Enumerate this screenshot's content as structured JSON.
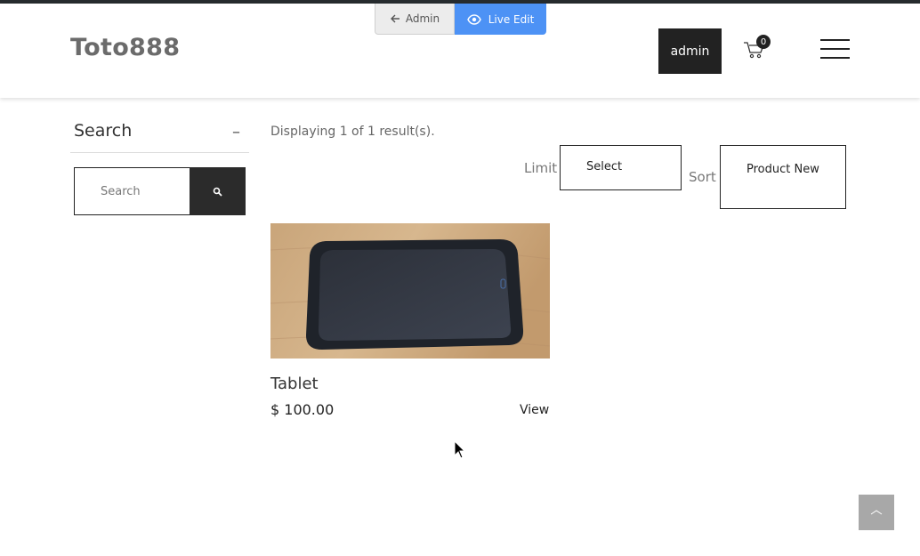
{
  "admin_bar": {
    "admin_label": "Admin",
    "live_edit_label": "Live Edit"
  },
  "header": {
    "logo": "Toto888",
    "user_button": "admin",
    "cart_count": "0"
  },
  "sidebar": {
    "title": "Search",
    "toggle": "–",
    "search_placeholder": "Search"
  },
  "toolbar": {
    "results_text": "Displaying 1 of 1 result(s).",
    "limit_label": "Limit",
    "limit_value": "Select",
    "sort_label": "Sort",
    "sort_value": "Product New"
  },
  "products": [
    {
      "name": "Tablet",
      "price": "$ 100.00",
      "view_label": "View"
    }
  ],
  "colors": {
    "live_edit": "#4d92f5",
    "dark": "#222222",
    "to_top": "#a8a8a8"
  },
  "icons": [
    "arrow-left-icon",
    "eye-icon",
    "cart-icon",
    "hamburger-menu-icon",
    "search-icon",
    "chevron-up-icon",
    "mouse-cursor-icon"
  ]
}
